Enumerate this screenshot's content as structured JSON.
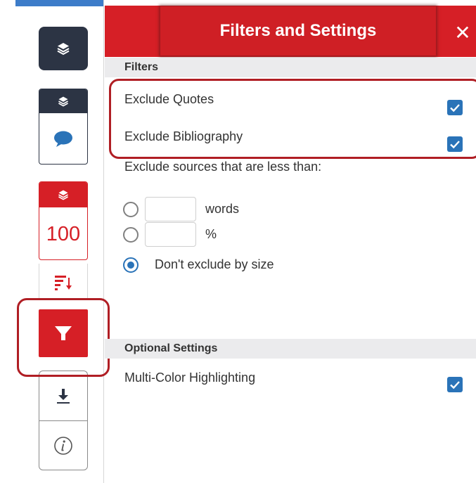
{
  "panel": {
    "title": "Filters and Settings",
    "close_label": "✕"
  },
  "sidebar": {
    "score": "100"
  },
  "filters": {
    "heading": "Filters",
    "exclude_quotes": {
      "label": "Exclude Quotes",
      "checked": true
    },
    "exclude_bibliography": {
      "label": "Exclude Bibliography",
      "checked": true
    },
    "exclude_sources_label": "Exclude sources that are less than:",
    "size_options": {
      "words_value": "",
      "words_label": "words",
      "percent_value": "",
      "percent_label": "%",
      "dont_exclude_label": "Don't exclude by size",
      "selected": "dont_exclude"
    }
  },
  "optional_settings": {
    "heading": "Optional Settings",
    "multi_color": {
      "label": "Multi-Color Highlighting",
      "checked": true
    }
  },
  "colors": {
    "brand_red": "#d61f26",
    "sidebar_dark": "#2c3444",
    "checkbox_blue": "#2a73b8",
    "annotation_outline": "#b01e24"
  }
}
